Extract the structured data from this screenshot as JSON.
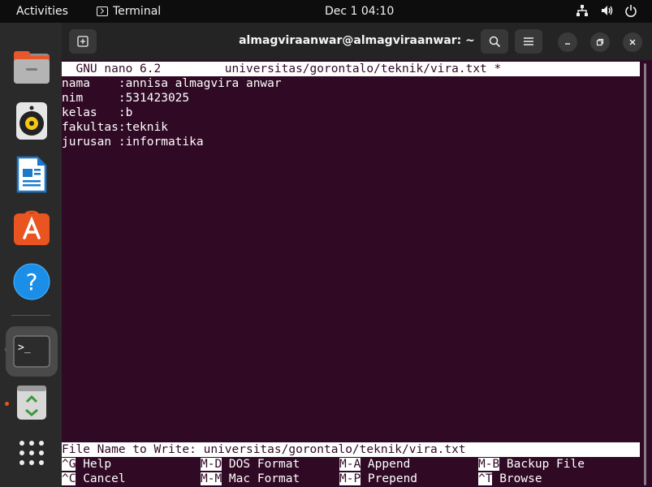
{
  "topbar": {
    "activities": "Activities",
    "app_name": "Terminal",
    "clock": "Dec 1  04:10"
  },
  "dock": {
    "items": [
      "Files",
      "Rhythmbox",
      "LibreOffice Writer",
      "Ubuntu Software",
      "Help",
      "Terminal",
      "Trash"
    ]
  },
  "window": {
    "title": "almagviraanwar@almagviraanwar: ~"
  },
  "nano": {
    "header": "  GNU nano 6.2         universitas/gorontalo/teknik/vira.txt *",
    "lines": [
      "nama    :annisa almagvira anwar",
      "nim     :531423025",
      "kelas   :b",
      "fakultas:teknik",
      "jurusan :informatika"
    ],
    "prompt": "File Name to Write: universitas/gorontalo/teknik/vira.txt",
    "shortcuts": [
      [
        {
          "key": "^G",
          "label": " Help"
        },
        {
          "key": "M-D",
          "label": " DOS Format"
        },
        {
          "key": "M-A",
          "label": " Append"
        },
        {
          "key": "M-B",
          "label": " Backup File"
        }
      ],
      [
        {
          "key": "^C",
          "label": " Cancel"
        },
        {
          "key": "M-M",
          "label": " Mac Format"
        },
        {
          "key": "M-P",
          "label": " Prepend"
        },
        {
          "key": "^T",
          "label": " Browse"
        }
      ]
    ]
  },
  "colors": {
    "terminal_bg": "#300a24",
    "accent": "#e95420"
  }
}
